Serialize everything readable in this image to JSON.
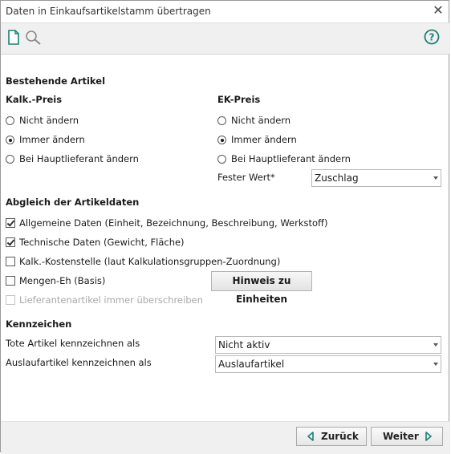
{
  "window": {
    "title": "Daten in Einkaufsartikelstamm übertragen"
  },
  "icons": {
    "new": "new-document-icon",
    "search": "search-icon",
    "help": "help-icon",
    "close": "close-icon"
  },
  "bestehende": {
    "heading": "Bestehende Artikel",
    "kalk": {
      "heading": "Kalk.-Preis",
      "options": [
        "Nicht ändern",
        "Immer ändern",
        "Bei Hauptlieferant ändern"
      ],
      "selected": 1
    },
    "ek": {
      "heading": "EK-Preis",
      "options": [
        "Nicht ändern",
        "Immer ändern",
        "Bei Hauptlieferant ändern"
      ],
      "selected": 1,
      "fester_label": "Fester Wert*",
      "fester_value": "Zuschlag"
    }
  },
  "abgleich": {
    "heading": "Abgleich der Artikeldaten",
    "items": [
      {
        "label": "Allgemeine Daten (Einheit, Bezeichnung, Beschreibung, Werkstoff)",
        "checked": true,
        "enabled": true
      },
      {
        "label": "Technische Daten (Gewicht, Fläche)",
        "checked": true,
        "enabled": true
      },
      {
        "label": "Kalk.-Kostenstelle (laut Kalkulationsgruppen-Zuordnung)",
        "checked": false,
        "enabled": true
      },
      {
        "label": "Mengen-Eh (Basis)",
        "checked": false,
        "enabled": true
      },
      {
        "label": "Lieferantenartikel immer überschreiben",
        "checked": false,
        "enabled": false
      }
    ],
    "hinweis_button": "Hinweis zu Einheiten"
  },
  "kennzeichen": {
    "heading": "Kennzeichen",
    "tote_label": "Tote Artikel kennzeichnen als",
    "tote_value": "Nicht aktiv",
    "auslauf_label": "Auslaufartikel kennzeichnen als",
    "auslauf_value": "Auslaufartikel"
  },
  "footer": {
    "back": "Zurück",
    "next": "Weiter"
  },
  "colors": {
    "accent_teal": "#1a7f7a",
    "toolbar_bg": "#f0f0f0"
  }
}
